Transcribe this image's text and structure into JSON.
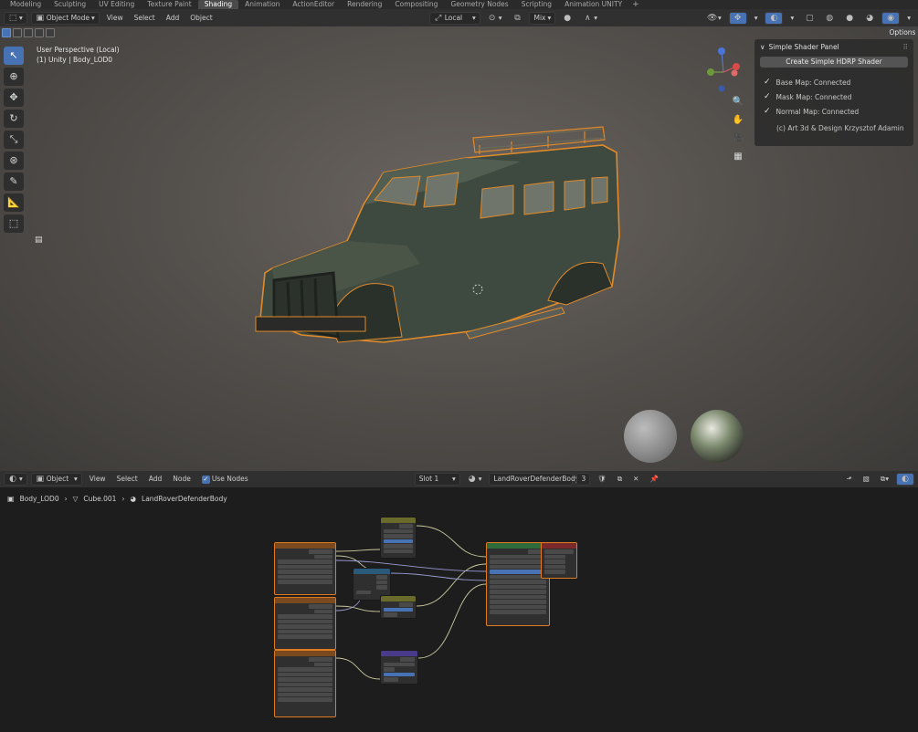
{
  "workspace_tabs": [
    "Modeling",
    "Sculpting",
    "UV Editing",
    "Texture Paint",
    "Shading",
    "Animation",
    "ActionEditor",
    "Rendering",
    "Compositing",
    "Geometry Nodes",
    "Scripting",
    "Animation UNITY"
  ],
  "active_tab": "Shading",
  "viewport_header": {
    "mode": "Object Mode",
    "menus": [
      "View",
      "Select",
      "Add",
      "Object"
    ],
    "transform_orientation": "Local",
    "blend_mode": "Mix"
  },
  "viewport": {
    "perspective_label": "User Perspective (Local)",
    "object_label": "(1) Unity | Body_LOD0",
    "options_label": "Options"
  },
  "shader_panel": {
    "title": "Simple Shader Panel",
    "button": "Create Simple HDRP Shader",
    "status": [
      "Base Map: Connected",
      "Mask Map: Connected",
      "Normal Map: Connected"
    ],
    "credit": "(c) Art 3d & Design Krzysztof Adamin"
  },
  "node_editor_header": {
    "type": "Object",
    "menus": [
      "View",
      "Select",
      "Add",
      "Node"
    ],
    "use_nodes_label": "Use Nodes",
    "slot": "Slot 1",
    "material": "LandRoverDefenderBody",
    "user_count": "3"
  },
  "breadcrumb": [
    "Body_LOD0",
    "Cube.001",
    "LandRoverDefenderBody"
  ],
  "colors": {
    "accent": "#4772b3",
    "selection": "#e07a1f",
    "header_bg": "#303030"
  }
}
